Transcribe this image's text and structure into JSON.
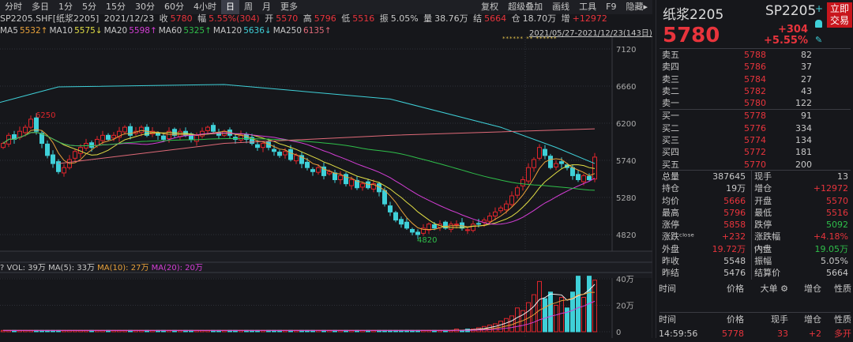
{
  "tabs": [
    "分时",
    "多日",
    "1分",
    "5分",
    "15分",
    "30分",
    "60分",
    "4小时",
    "日",
    "周",
    "月",
    "更多"
  ],
  "active_tab": "日",
  "tools": [
    "复权",
    "超级叠加",
    "画线",
    "工具",
    "F9",
    "隐藏▸"
  ],
  "info": {
    "symbol": "SP2205.SHF[纸浆2205]",
    "date": "2021/12/23",
    "close_label": "收",
    "close": "5780",
    "range_label": "幅",
    "range": "5.55%(304)",
    "open_label": "开",
    "open": "5570",
    "high_label": "高",
    "high": "5796",
    "low_label": "低",
    "low": "5516",
    "amp_label": "振",
    "amp": "5.05%",
    "vol_label": "量",
    "vol": "38.76万",
    "settle_label": "结",
    "settle": "5664",
    "oi_label": "仓",
    "oi": "18.70万",
    "inc_label": "增",
    "inc": "+12972"
  },
  "ma": [
    {
      "label": "MA5",
      "value": "5532↑",
      "color": "#e8a13a"
    },
    {
      "label": "MA10",
      "value": "5575↓",
      "color": "#e3df45"
    },
    {
      "label": "MA20",
      "value": "5598↑",
      "color": "#d53ed6"
    },
    {
      "label": "MA60",
      "value": "5325↑",
      "color": "#2fbf4a"
    },
    {
      "label": "MA120",
      "value": "5636↓",
      "color": "#3fd0d8"
    },
    {
      "label": "MA250",
      "value": "6135↑",
      "color": "#e06a78"
    }
  ],
  "date_range": "2021/05/27-2021/12/23(143日)",
  "stars": "****** ** ******",
  "vol_header": {
    "q": "?",
    "vol": "VOL: 39万",
    "ma5": "MA(5): 33万",
    "ma10": "MA(10): 27万",
    "ma20": "MA(20): 20万"
  },
  "chart_data": {
    "type": "candlestick",
    "y_ticks": [
      "7120",
      "6660",
      "6200",
      "5740",
      "5280",
      "4820"
    ],
    "ylim": [
      4700,
      7200
    ],
    "annotations": [
      {
        "text": "6250",
        "index": 5
      },
      {
        "text": "4820",
        "index": 74
      }
    ],
    "close": [
      5950,
      6050,
      6000,
      6100,
      6150,
      6250,
      6100,
      5950,
      5800,
      5700,
      5600,
      5650,
      5750,
      5850,
      5900,
      5950,
      5900,
      6000,
      6050,
      6000,
      6050,
      6100,
      6150,
      6050,
      6100,
      6150,
      6050,
      6100,
      6050,
      6000,
      6100,
      6050,
      6100,
      6050,
      6000,
      6050,
      6100,
      6150,
      6100,
      6050,
      6100,
      6050,
      6000,
      6050,
      6000,
      5950,
      5900,
      5950,
      5900,
      5850,
      5800,
      5850,
      5750,
      5800,
      5700,
      5650,
      5600,
      5650,
      5550,
      5600,
      5500,
      5550,
      5450,
      5500,
      5400,
      5450,
      5400,
      5450,
      5350,
      5200,
      5100,
      5000,
      4950,
      4900,
      4850,
      4820,
      4900,
      4950,
      4900,
      4950,
      4900,
      4950,
      4950,
      4900,
      4880,
      4950,
      4950,
      5000,
      5050,
      5100,
      5150,
      5200,
      5300,
      5400,
      5500,
      5650,
      5750,
      5900,
      5800,
      5650,
      5700,
      5700,
      5650,
      5550,
      5500,
      5550,
      5500,
      5780
    ],
    "ma120_points": [
      [
        10,
        6650
      ],
      [
        40,
        6680
      ],
      [
        70,
        6500
      ],
      [
        90,
        6150
      ],
      [
        100,
        5900
      ],
      [
        107,
        5700
      ]
    ],
    "ma250_points": [
      [
        10,
        5700
      ],
      [
        40,
        5950
      ],
      [
        70,
        6050
      ],
      [
        107,
        6130
      ]
    ],
    "vol_ticks": [
      "40万",
      "20万",
      "0"
    ],
    "vol_max": 40,
    "volume": [
      1,
      1,
      1,
      1,
      1,
      1,
      1,
      1,
      1,
      1,
      1,
      1,
      1,
      1,
      1,
      1,
      1,
      1,
      1,
      1,
      1,
      1,
      1,
      1,
      1,
      1,
      1,
      1,
      1,
      1,
      1,
      1,
      1,
      1,
      1,
      1,
      1,
      1,
      1,
      1,
      1,
      1,
      1,
      1,
      1,
      1,
      1,
      1,
      1,
      1,
      1,
      1,
      1,
      1,
      1,
      1,
      1,
      1,
      1,
      1,
      1,
      1,
      1,
      1,
      1,
      1,
      1,
      1,
      1,
      1,
      1,
      1,
      1,
      1,
      1,
      1,
      1,
      1,
      1,
      1,
      1,
      1,
      2,
      1,
      2,
      2,
      3,
      4,
      5,
      6,
      8,
      10,
      12,
      18,
      16,
      22,
      28,
      38,
      25,
      30,
      20,
      26,
      18,
      30,
      42,
      26,
      42,
      39
    ]
  },
  "right": {
    "name": "纸浆2205",
    "code": "SP2205",
    "price": "5780",
    "chg": "+304",
    "pct": "+5.55%",
    "trade_btn": "立即交易",
    "asks": [
      [
        "卖五",
        "5788",
        "82"
      ],
      [
        "卖四",
        "5786",
        "37"
      ],
      [
        "卖三",
        "5784",
        "27"
      ],
      [
        "卖二",
        "5782",
        "43"
      ],
      [
        "卖一",
        "5780",
        "122"
      ]
    ],
    "bids": [
      [
        "买一",
        "5778",
        "91"
      ],
      [
        "买二",
        "5776",
        "334"
      ],
      [
        "买三",
        "5774",
        "134"
      ],
      [
        "买四",
        "5772",
        "181"
      ],
      [
        "买五",
        "5770",
        "200"
      ]
    ],
    "stats": [
      [
        "总量",
        "387645",
        "",
        "现手",
        "13",
        ""
      ],
      [
        "持仓",
        "19万",
        "",
        "增仓",
        "+12972",
        "red"
      ],
      [
        "均价",
        "5666",
        "red",
        "开盘",
        "5570",
        "red"
      ],
      [
        "最高",
        "5796",
        "red",
        "最低",
        "5516",
        "red"
      ],
      [
        "涨停",
        "5858",
        "red",
        "跌停",
        "5092",
        "grn"
      ],
      [
        "涨跌ᶜˡᵒˢᵉ",
        "+232",
        "red",
        "涨跌幅ᶜˡᵒˢᵉ",
        "+4.18%",
        "red"
      ],
      [
        "外盘",
        "19.72万",
        "red",
        "内盘",
        "19.05万",
        "grn"
      ],
      [
        "昨收",
        "5548",
        "",
        "振幅",
        "5.05%",
        ""
      ],
      [
        "昨结",
        "5476",
        "",
        "结算价",
        "5664",
        ""
      ]
    ],
    "trade_header": [
      "时间",
      "价格",
      "大单",
      "增仓",
      "性质"
    ],
    "tick_header": [
      "时间",
      "价格",
      "现手",
      "增仓",
      "性质"
    ],
    "tick": [
      "14:59:56",
      "5778",
      "33",
      "+2",
      "多开"
    ]
  }
}
